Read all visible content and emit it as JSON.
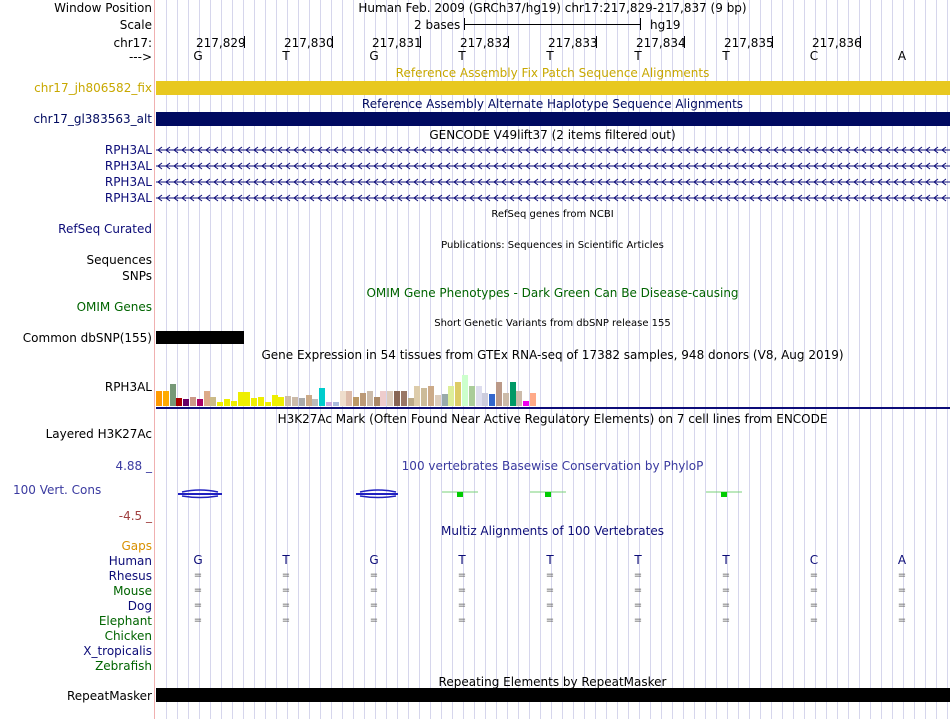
{
  "header": {
    "window_position_label": "Window Position",
    "window_position_value": "Human Feb. 2009 (GRCh37/hg19)   chr17:217,829-217,837 (9 bp)",
    "scale_label": "Scale",
    "scale_value": "2 bases",
    "scale_db": "hg19",
    "chrom_label": "chr17:",
    "strand_label": "--->",
    "ticks": [
      "217,829",
      "217,830",
      "217,831",
      "217,832",
      "217,833",
      "217,834",
      "217,835",
      "217,836"
    ],
    "bases": [
      "G",
      "T",
      "G",
      "T",
      "T",
      "T",
      "T",
      "C",
      "A"
    ]
  },
  "tracks": {
    "fix_title": "Reference Assembly Fix Patch Sequence Alignments",
    "fix_label": "chr17_jh806582_fix",
    "alt_title": "Reference Assembly Alternate Haplotype Sequence Alignments",
    "alt_label": "chr17_gl383563_alt",
    "gencode_title": "GENCODE V49lift37 (2 items filtered out)",
    "gencode_items": [
      "RPH3AL",
      "RPH3AL",
      "RPH3AL",
      "RPH3AL"
    ],
    "refseq_title": "RefSeq genes from NCBI",
    "refseq_label": "RefSeq Curated",
    "pubs_title": "Publications: Sequences in Scientific Articles",
    "pubs_label": "Sequences",
    "snps_label": "SNPs",
    "omim_title": "OMIM Gene Phenotypes - Dark Green Can Be Disease-causing",
    "omim_label": "OMIM Genes",
    "dbsnp_title": "Short Genetic Variants from dbSNP release 155",
    "dbsnp_label": "Common dbSNP(155)",
    "gtex_title": "Gene Expression in 54 tissues from GTEx RNA-seq of 17382 samples, 948 donors (V8, Aug 2019)",
    "gtex_label": "RPH3AL",
    "h3k_title": "H3K27Ac Mark (Often Found Near Active Regulatory Elements) on 7 cell lines from ENCODE",
    "h3k_label": "Layered H3K27Ac",
    "cons_title": "100 vertebrates Basewise Conservation by PhyloP",
    "cons_label": "100 Vert. Cons",
    "cons_max": "4.88 _",
    "cons_min": "-4.5 _",
    "multiz_title": "Multiz Alignments of 100 Vertebrates",
    "gaps_label": "Gaps",
    "species": [
      "Human",
      "Rhesus",
      "Mouse",
      "Dog",
      "Elephant",
      "Chicken",
      "X_tropicalis",
      "Zebrafish"
    ],
    "repeat_title": "Repeating Elements by RepeatMasker",
    "repeat_label": "RepeatMasker"
  },
  "gtex_colors": [
    "#ff9900",
    "#ffaa00",
    "#779977",
    "#aa0000",
    "#660066",
    "#cc9988",
    "#aa0066",
    "#ddaa88",
    "#ccbb88",
    "#eeee00",
    "#eeee00",
    "#eeee00",
    "#eeee00",
    "#eeee00",
    "#eeee00",
    "#eeee00",
    "#eeee00",
    "#eeee00",
    "#eeee00",
    "#ccbbaa",
    "#ccbbaa",
    "#aaaaaa",
    "#ccaa88",
    "#bbbbbb",
    "#00cccc",
    "#ccaadd",
    "#aabbdd",
    "#eeddcc",
    "#ddbbaa",
    "#bb9966",
    "#bb9977",
    "#ccbbaa",
    "#aa8866",
    "#eecccc",
    "#ddccbb",
    "#886655",
    "#997766",
    "#bbaa88",
    "#ddccaa",
    "#ccbb99",
    "#ccaa88",
    "#ddccbb",
    "#99aaaa",
    "#ddee99",
    "#ddcc66",
    "#ccffcc",
    "#aacc99",
    "#ddddee",
    "#ccccdd",
    "#3366cc",
    "#bb9988",
    "#ccbbaa",
    "#009966",
    "#ccbbaa",
    "#ee00ee",
    "#ffaa88"
  ],
  "gtex_values": [
    0.35,
    0.35,
    0.5,
    0.18,
    0.15,
    0.2,
    0.15,
    0.35,
    0.2,
    0.1,
    0.15,
    0.12,
    0.32,
    0.32,
    0.18,
    0.2,
    0.1,
    0.25,
    0.2,
    0.22,
    0.2,
    0.18,
    0.25,
    0.15,
    0.42,
    0.1,
    0.1,
    0.35,
    0.35,
    0.2,
    0.3,
    0.35,
    0.2,
    0.35,
    0.35,
    0.35,
    0.35,
    0.18,
    0.45,
    0.4,
    0.45,
    0.25,
    0.28,
    0.45,
    0.55,
    0.7,
    0.45,
    0.45,
    0.3,
    0.28,
    0.55,
    0.3,
    0.55,
    0.35,
    0.12,
    0.3
  ]
}
